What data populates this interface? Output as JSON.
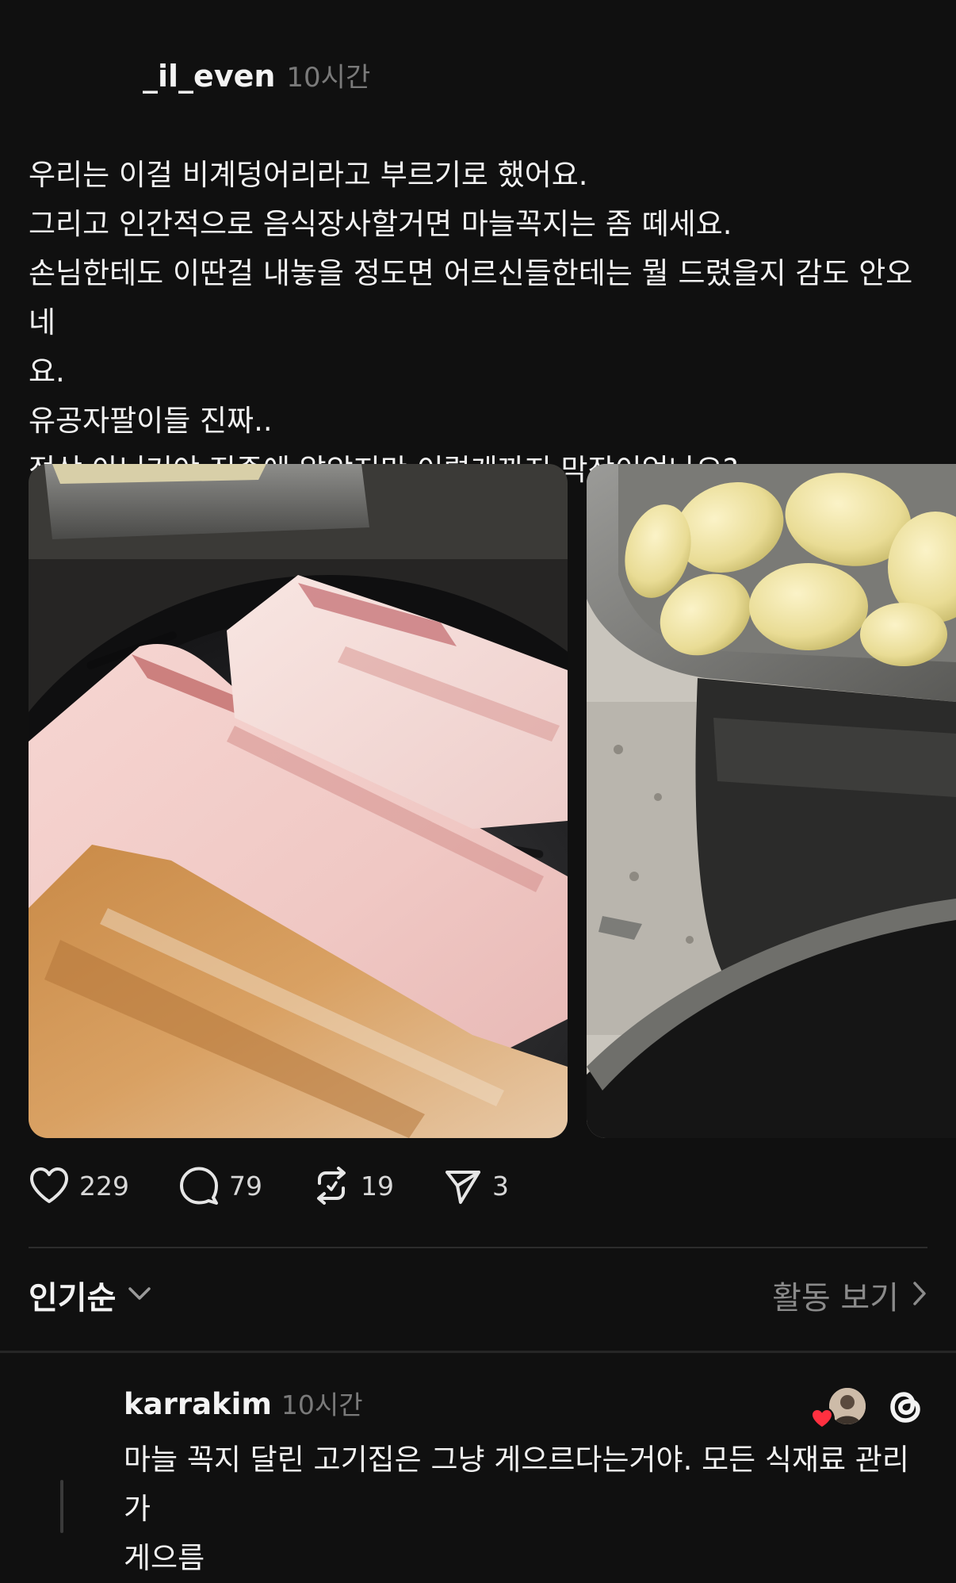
{
  "post": {
    "username": "_il_even",
    "time": "10시간",
    "lines": [
      "우리는 이걸 비계덩어리라고 부르기로 했어요.",
      "그리고 인간적으로 음식장사할거면 마늘꼭지는 좀 떼세요.",
      "손님한테도 이딴걸 내놓을 정도면 어르신들한테는 뭘 드렸을지 감도 안오네",
      "요.",
      "유공자팔이들 진짜..",
      "정상 아닌거야 진즉에 알았지만 이렇게까지 막장이었나요?"
    ],
    "media": [
      {
        "name": "pork-belly-photo",
        "icon": "photo"
      },
      {
        "name": "garlic-photo",
        "icon": "photo"
      }
    ]
  },
  "actions": {
    "likes": "229",
    "comments": "79",
    "reposts": "19",
    "shares": "3"
  },
  "sort": {
    "label": "인기순",
    "activity_label": "활동 보기"
  },
  "comment": {
    "username": "karrakim",
    "time": "10시간",
    "lines": [
      "마늘 꼭지 달린 고기집은 그냥 게으르다는거야. 모든 식재료 관리가",
      "게으름"
    ]
  },
  "colors": {
    "background": "#101010",
    "text": "#f3f3f3",
    "muted": "#7a7a7a",
    "heart": "#ff3040"
  }
}
